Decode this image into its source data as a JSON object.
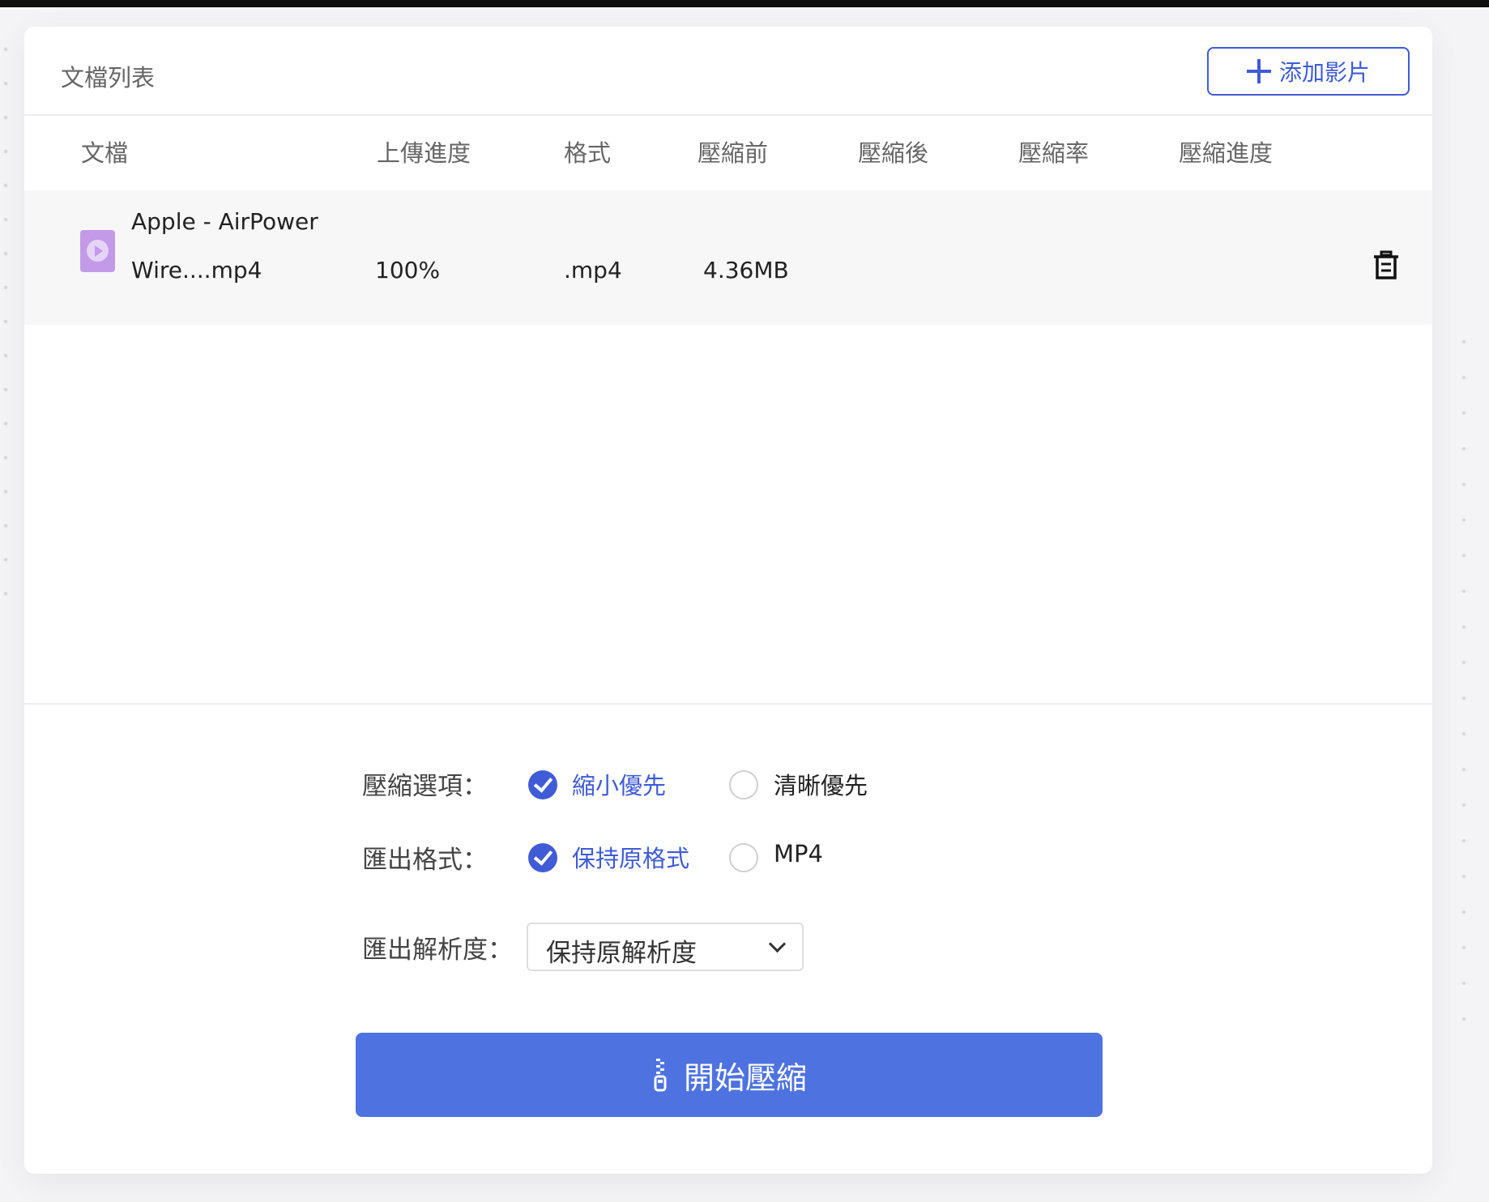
{
  "panel": {
    "title": "文檔列表",
    "add_button_label": "添加影片"
  },
  "table": {
    "headers": [
      "文檔",
      "上傳進度",
      "格式",
      "壓縮前",
      "壓縮後",
      "壓縮率",
      "壓縮進度"
    ],
    "rows": [
      {
        "name_line1": "Apple - AirPower",
        "name_line2": "Wire....mp4",
        "upload_progress": "100%",
        "format": ".mp4",
        "size_before": "4.36MB",
        "size_after": "",
        "ratio": "",
        "compress_progress": ""
      }
    ]
  },
  "options": {
    "compression": {
      "label": "壓縮選項：",
      "choices": [
        "縮小優先",
        "清晰優先"
      ],
      "selected": "縮小優先"
    },
    "export_format": {
      "label": "匯出格式：",
      "choices": [
        "保持原格式",
        "MP4"
      ],
      "selected": "保持原格式"
    },
    "resolution": {
      "label": "匯出解析度：",
      "value": "保持原解析度"
    }
  },
  "start_button_label": "開始壓縮",
  "colors": {
    "accent": "#3f5bd6",
    "start_button": "#4e72e0",
    "file_icon": "#c39ae8",
    "row_background": "#f7f7f7"
  },
  "icons": [
    "plus-icon",
    "video-file-icon",
    "trash-icon",
    "radio-checked-icon",
    "radio-unchecked-icon",
    "chevron-down-icon",
    "zip-icon"
  ]
}
